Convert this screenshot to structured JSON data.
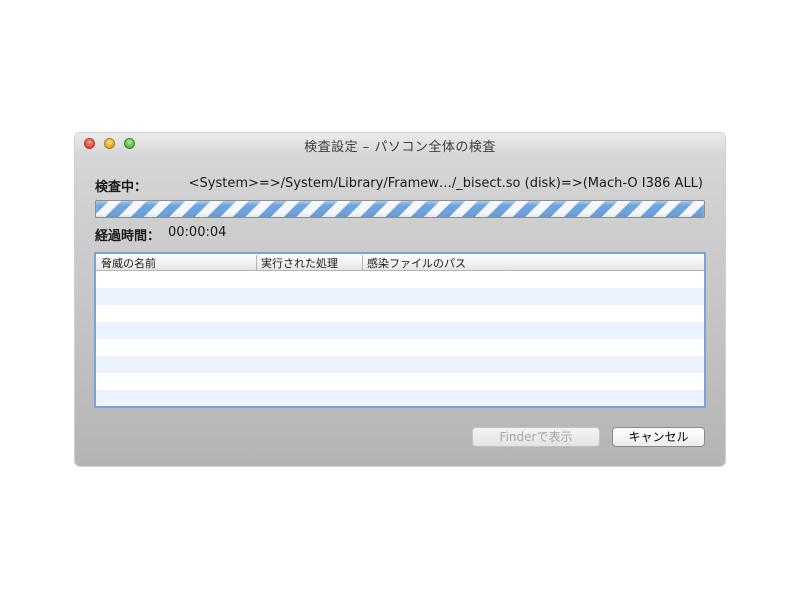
{
  "window": {
    "title": "検査設定 – パソコン全体の検査"
  },
  "scan": {
    "checking_label": "検査中：",
    "current_path": "<System>=>/System/Library/Framew…/_bisect.so (disk)=>(Mach-O I386 ALL)",
    "elapsed_label": "経過時間：",
    "elapsed_time": "00:00:04",
    "progress_state": "indeterminate"
  },
  "results_table": {
    "columns": [
      "脅威の名前",
      "実行された処理",
      "感染ファイルのパス"
    ],
    "rows": []
  },
  "buttons": {
    "show_in_finder": "Finderで表示",
    "cancel": "キャンセル"
  },
  "colors": {
    "progress_stripe": "#6ea3de",
    "table_focus_border": "#7aa2d6",
    "alternate_row": "#edf3fe"
  }
}
